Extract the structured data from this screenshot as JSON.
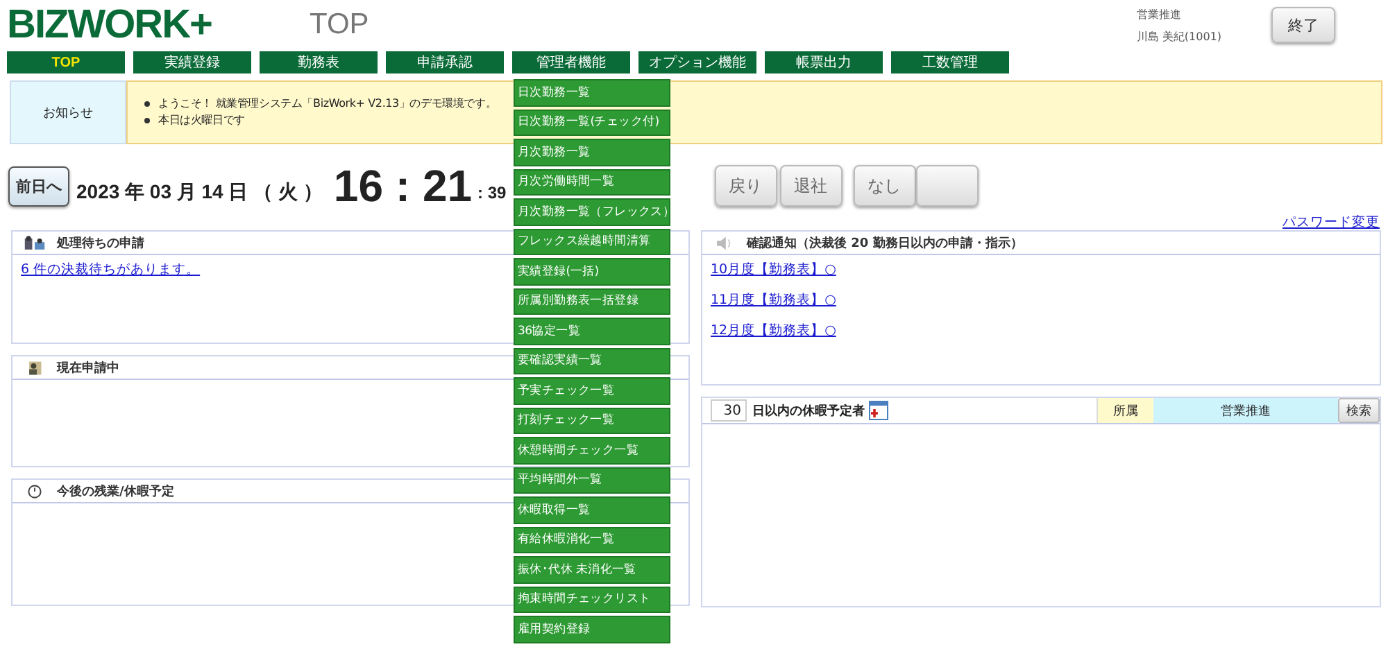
{
  "header": {
    "logo": "BIZWORK+",
    "page_title": "TOP",
    "user_department": "営業推進",
    "user_name": "川島 美紀(1001)",
    "logout_button": "終了"
  },
  "nav": [
    {
      "label": "TOP",
      "selected": true
    },
    {
      "label": "実績登録",
      "selected": false
    },
    {
      "label": "勤務表",
      "selected": false
    },
    {
      "label": "申請承認",
      "selected": false
    },
    {
      "label": "管理者機能",
      "selected": false
    },
    {
      "label": "オプション機能",
      "selected": false
    },
    {
      "label": "帳票出力",
      "selected": false
    },
    {
      "label": "工数管理",
      "selected": false
    }
  ],
  "notice": {
    "label": "お知らせ",
    "items": [
      "ようこそ！ 就業管理システム「BizWork+ V2.13」のデモ環境です。",
      "本日は火曜日です"
    ]
  },
  "date_bar": {
    "prev_button": "前日へ",
    "date": "2023 年 03 月 14 日 （ 火 ）",
    "time": "16 : 21",
    "seconds": ": 39",
    "buttons": [
      "戻り",
      "退社",
      "なし"
    ]
  },
  "password_link": "パスワード変更",
  "left_panels": [
    {
      "kind": "pending",
      "title": "処理待ちの申請",
      "links": [
        "6 件の決裁待ちがあります。"
      ]
    },
    {
      "kind": "current",
      "title": "現在申請中"
    },
    {
      "kind": "schedule",
      "title": "今後の残業/休暇予定"
    }
  ],
  "confirm_panel": {
    "title": "確認通知（決裁後 20 勤務日以内の申請・指示）",
    "links": [
      "10月度【勤務表】○",
      "11月度【勤務表】○",
      "12月度【勤務表】○"
    ]
  },
  "vacation_panel": {
    "days": "30",
    "label": "日以内の休暇予定者",
    "department_label": "所属",
    "department": "営業推進",
    "search_button": "検索"
  },
  "admin_menu": [
    "日次勤務一覧",
    "日次勤務一覧(チェック付)",
    "月次勤務一覧",
    "月次労働時間一覧",
    "月次勤務一覧（フレックス）",
    "フレックス繰越時間清算",
    "実績登録(一括)",
    "所属別勤務表一括登録",
    "36協定一覧",
    "要確認実績一覧",
    "予実チェック一覧",
    "打刻チェック一覧",
    "休憩時間チェック一覧",
    "平均時間外一覧",
    "休暇取得一覧",
    "有給休暇消化一覧",
    "振休･代休 未消化一覧",
    "拘束時間チェックリスト",
    "雇用契約登録"
  ]
}
